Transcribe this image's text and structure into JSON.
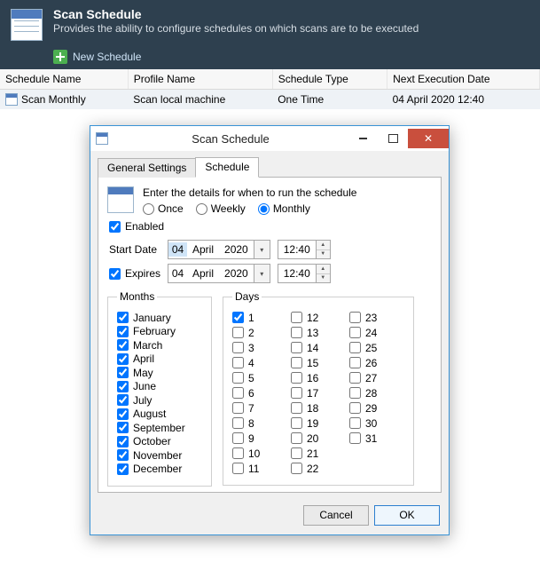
{
  "header": {
    "title": "Scan Schedule",
    "subtitle": "Provides the ability to configure schedules on which scans are to be executed",
    "new_schedule": "New Schedule"
  },
  "grid": {
    "cols": {
      "schedule_name": "Schedule Name",
      "profile_name": "Profile Name",
      "schedule_type": "Schedule Type",
      "next_exec": "Next Execution Date"
    },
    "row": {
      "schedule_name": "Scan Monthly",
      "profile_name": "Scan local machine",
      "schedule_type": "One Time",
      "next_exec": "04 April 2020 12:40"
    }
  },
  "dialog": {
    "title": "Scan Schedule",
    "tabs": {
      "general": "General Settings",
      "schedule": "Schedule"
    },
    "intro": "Enter the details for when to run the schedule",
    "freq": {
      "once": "Once",
      "weekly": "Weekly",
      "monthly": "Monthly",
      "selected": "monthly"
    },
    "enabled_label": "Enabled",
    "enabled": true,
    "start_label": "Start Date",
    "start": {
      "day": "04",
      "month": "April",
      "year": "2020",
      "time": "12:40"
    },
    "expires_label": "Expires",
    "expires_checked": true,
    "expires": {
      "day": "04",
      "month": "April",
      "year": "2020",
      "time": "12:40"
    },
    "months_legend": "Months",
    "months": [
      "January",
      "February",
      "March",
      "April",
      "May",
      "June",
      "July",
      "August",
      "September",
      "October",
      "November",
      "December"
    ],
    "months_checked": [
      true,
      true,
      true,
      true,
      true,
      true,
      true,
      true,
      true,
      true,
      true,
      true
    ],
    "days_legend": "Days",
    "days_count": 31,
    "days_checked": [
      1
    ],
    "buttons": {
      "cancel": "Cancel",
      "ok": "OK"
    }
  }
}
